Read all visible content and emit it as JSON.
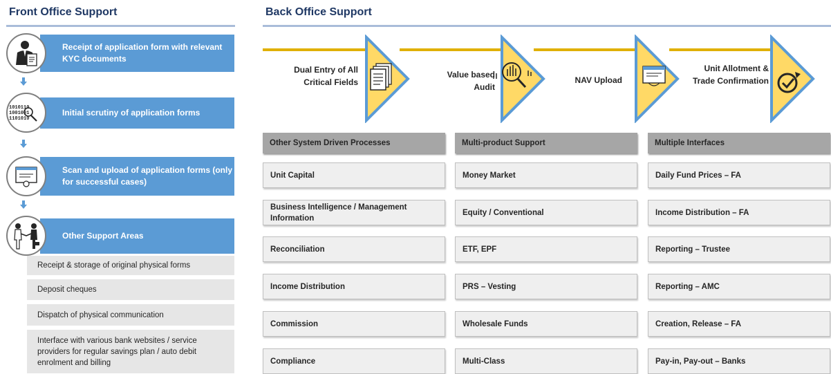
{
  "front_office": {
    "title": "Front Office Support",
    "steps": [
      {
        "label": "Receipt of application form with relevant KYC documents",
        "icon": "person-document-icon"
      },
      {
        "label": "Initial scrutiny of application forms",
        "icon": "binary-magnifier-icon",
        "binary": [
          "1010110",
          "1001001",
          "1101010"
        ]
      },
      {
        "label": "Scan and upload of application forms (only for successful cases)",
        "icon": "scan-screen-icon"
      },
      {
        "label": "Other Support Areas",
        "icon": "handshake-icon"
      }
    ],
    "support_areas": [
      "Receipt & storage of original physical forms",
      "Deposit cheques",
      "Dispatch of physical communication",
      "Interface with various bank websites / service providers for regular savings plan / auto debit enrolment and billing"
    ]
  },
  "back_office": {
    "title": "Back Office Support",
    "process": [
      {
        "label": "Dual Entry of All Critical Fields",
        "icon": "documents-icon"
      },
      {
        "label": "Value based Audit",
        "icon": "chart-magnifier-icon"
      },
      {
        "label": "NAV Upload",
        "icon": "upload-screen-icon"
      },
      {
        "label": "Unit Allotment & Trade Confirmation",
        "icon": "check-circle-icon"
      }
    ],
    "columns": [
      {
        "header": "Other System Driven Processes",
        "items": [
          "Unit Capital",
          "Business Intelligence / Management Information",
          "Reconciliation",
          "Income Distribution",
          "Commission",
          "Compliance"
        ]
      },
      {
        "header": "Multi-product Support",
        "items": [
          "Money Market",
          "Equity / Conventional",
          "ETF, EPF",
          "PRS – Vesting",
          "Wholesale Funds",
          "Multi-Class"
        ]
      },
      {
        "header": "Multiple Interfaces",
        "items": [
          "Daily Fund Prices – FA",
          "Income Distribution – FA",
          "Reporting – Trustee",
          "Reporting – AMC",
          "Creation, Release – FA",
          "Pay-in, Pay-out – Banks"
        ]
      }
    ]
  },
  "colors": {
    "title": "#1F3864",
    "step_bar": "#5B9BD5",
    "rule": "#A9BCD9",
    "chevron_fill": "#FFD966",
    "chevron_border": "#5B9BD5",
    "gold_line": "#E0B000",
    "header_grey": "#A6A6A6",
    "cell_grey": "#EFEFEF"
  }
}
